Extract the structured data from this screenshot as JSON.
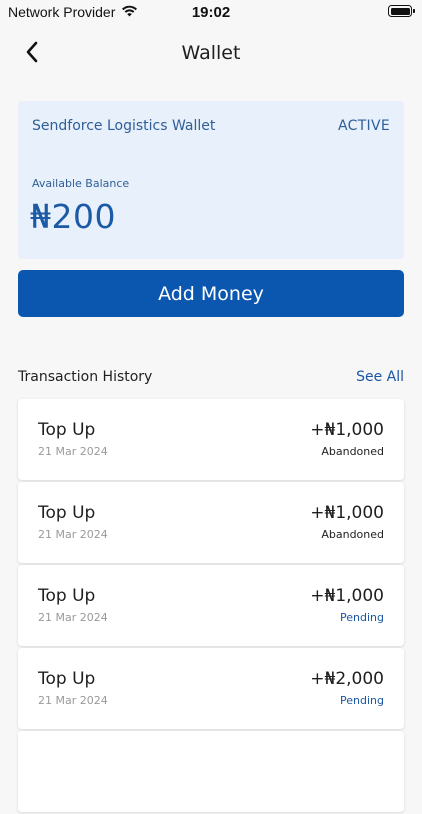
{
  "status_bar": {
    "carrier": "Network Provider",
    "time": "19:02"
  },
  "header": {
    "title": "Wallet"
  },
  "wallet": {
    "name": "Sendforce Logistics Wallet",
    "status": "ACTIVE",
    "balance_label": "Available Balance",
    "balance": "₦200"
  },
  "actions": {
    "add_money_label": "Add Money"
  },
  "transactions": {
    "section_title": "Transaction History",
    "see_all_label": "See All",
    "items": [
      {
        "title": "Top Up",
        "date": "21 Mar 2024",
        "amount": "+₦1,000",
        "status": "Abandoned"
      },
      {
        "title": "Top Up",
        "date": "21 Mar 2024",
        "amount": "+₦1,000",
        "status": "Abandoned"
      },
      {
        "title": "Top Up",
        "date": "21 Mar 2024",
        "amount": "+₦1,000",
        "status": "Pending"
      },
      {
        "title": "Top Up",
        "date": "21 Mar 2024",
        "amount": "+₦2,000",
        "status": "Pending"
      }
    ]
  },
  "colors": {
    "brand_primary": "#0b57b0",
    "wallet_card_bg": "#e7f0fb",
    "pending_status": "#1a56a3",
    "background": "#f7f7f8"
  },
  "icons": {
    "wifi": "wifi-icon",
    "battery": "battery-icon",
    "back": "chevron-left-icon"
  }
}
